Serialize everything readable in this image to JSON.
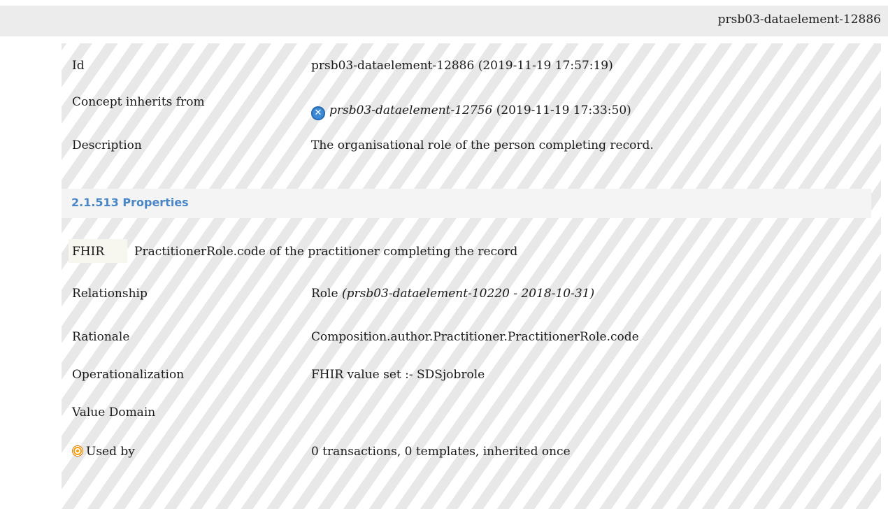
{
  "header": {
    "crumb": "prsb03-dataelement-12886"
  },
  "details": {
    "id_label": "Id",
    "id_value": "prsb03-dataelement-12886 (2019-11-19 17:57:19)",
    "inherits_label": "Concept inherits from",
    "inherits_link": "prsb03-dataelement-12756",
    "inherits_date": "(2019-11-19 17:33:50)",
    "description_label": "Description",
    "description_value": "The organisational role of the person completing record."
  },
  "properties": {
    "heading": "2.1.513 Properties",
    "fhir_label": "FHIR",
    "fhir_text": "PractitionerRole.code of the practitioner completing the record",
    "relationship_label": "Relationship",
    "relationship_value": "Role",
    "relationship_ref": "(prsb03-dataelement-10220 - 2018-10-31)",
    "rationale_label": "Rationale",
    "rationale_value": "Composition.author.Practitioner.PractitionerRole.code",
    "operationalization_label": "Operationalization",
    "operationalization_value": "FHIR value set :- SDSjobrole",
    "value_domain_label": "Value Domain",
    "used_by_label": "Used by",
    "used_by_value": "0 transactions, 0 templates, inherited once"
  },
  "icons": {
    "inherits": "close-circle-icon",
    "used_by": "target-icon"
  },
  "colors": {
    "heading": "#4a86c5",
    "inherit_icon": "#3a8ad6",
    "used_by_icon": "#ff9a00"
  }
}
